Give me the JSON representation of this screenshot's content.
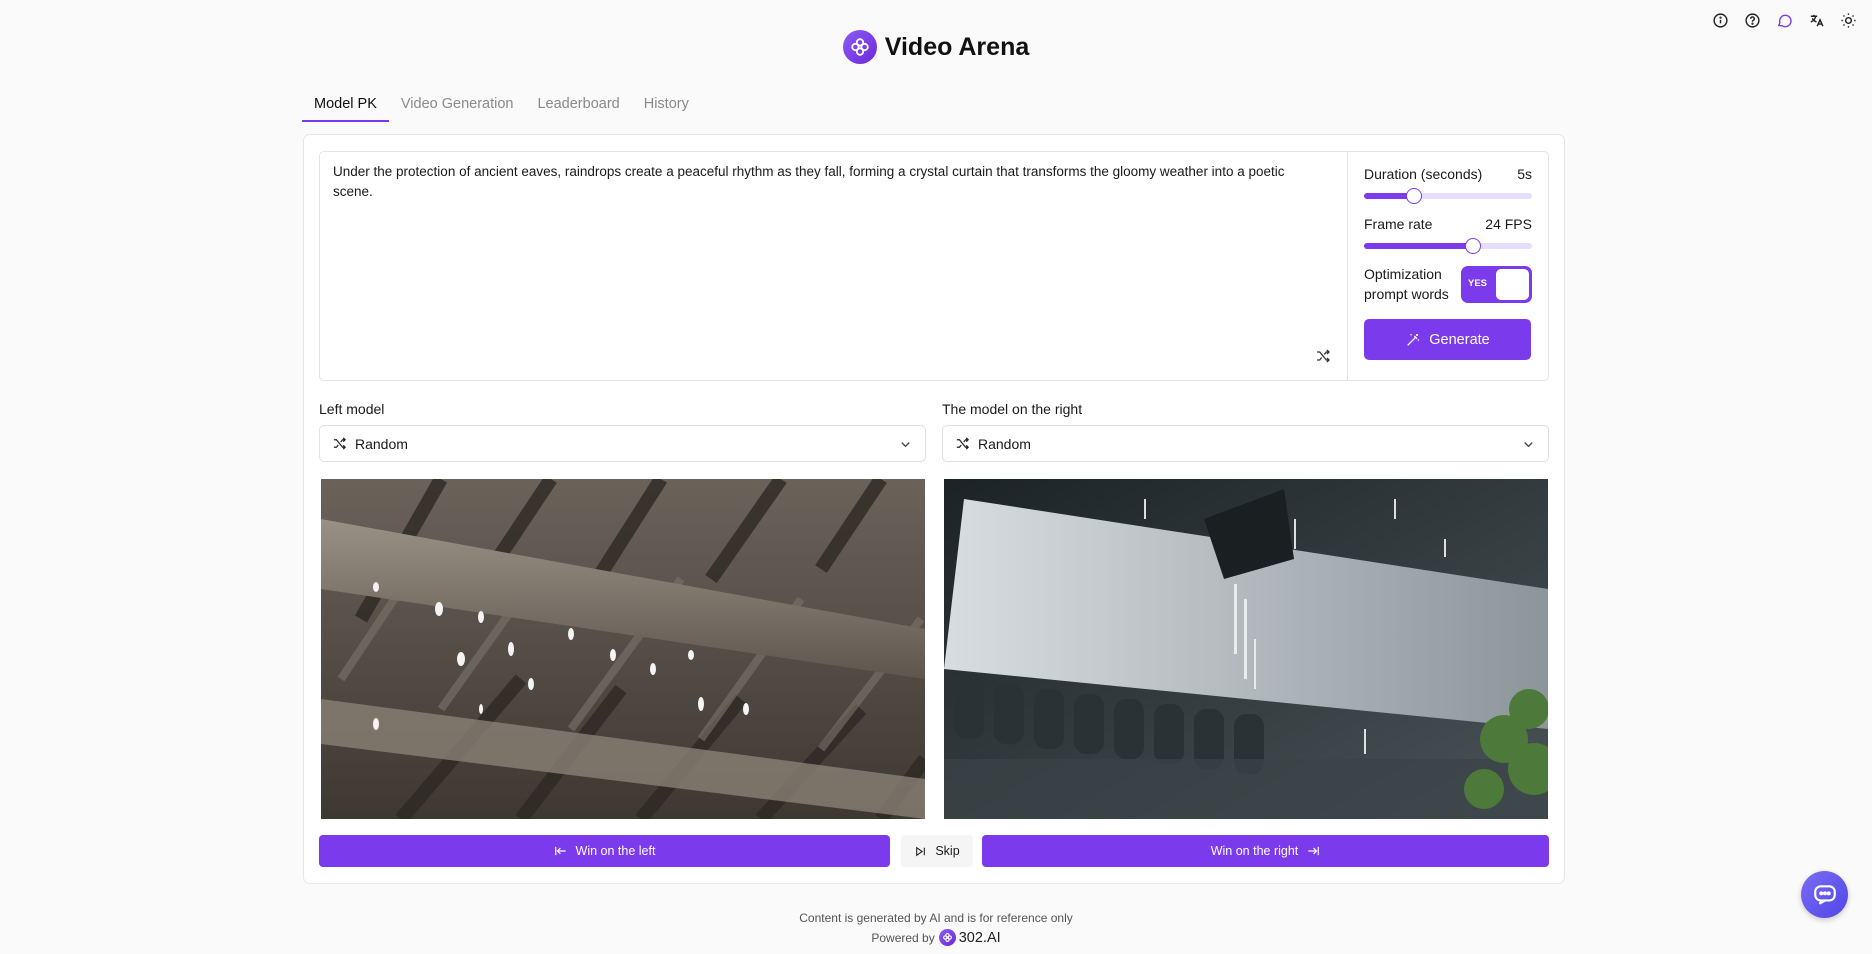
{
  "app": {
    "title": "Video Arena"
  },
  "top_icons": [
    "info-icon",
    "help-icon",
    "chat-icon",
    "translate-icon",
    "theme-icon"
  ],
  "tabs": [
    {
      "label": "Model PK",
      "active": true
    },
    {
      "label": "Video Generation",
      "active": false
    },
    {
      "label": "Leaderboard",
      "active": false
    },
    {
      "label": "History",
      "active": false
    }
  ],
  "prompt": {
    "text": "Under the protection of ancient eaves, raindrops create a peaceful rhythm as they fall, forming a crystal curtain that transforms the gloomy weather into a poetic scene."
  },
  "settings": {
    "duration_label": "Duration (seconds)",
    "duration_value": "5s",
    "duration_fraction": 0.3,
    "framerate_label": "Frame rate",
    "framerate_value": "24 FPS",
    "framerate_fraction": 0.65,
    "optimization_label": "Optimization prompt words",
    "optimization_toggle": "YES",
    "generate_label": "Generate"
  },
  "models": {
    "left_label": "Left model",
    "left_value": "Random",
    "right_label": "The model on the right",
    "right_value": "Random"
  },
  "votes": {
    "left_label": "Win on the left",
    "skip_label": "Skip",
    "right_label": "Win on the right"
  },
  "footer": {
    "disclaimer": "Content is generated by AI and is for reference only",
    "powered_by": "Powered by",
    "brand": "302.AI"
  },
  "colors": {
    "accent": "#7c3aed",
    "accent_light": "#e6dcfb"
  }
}
